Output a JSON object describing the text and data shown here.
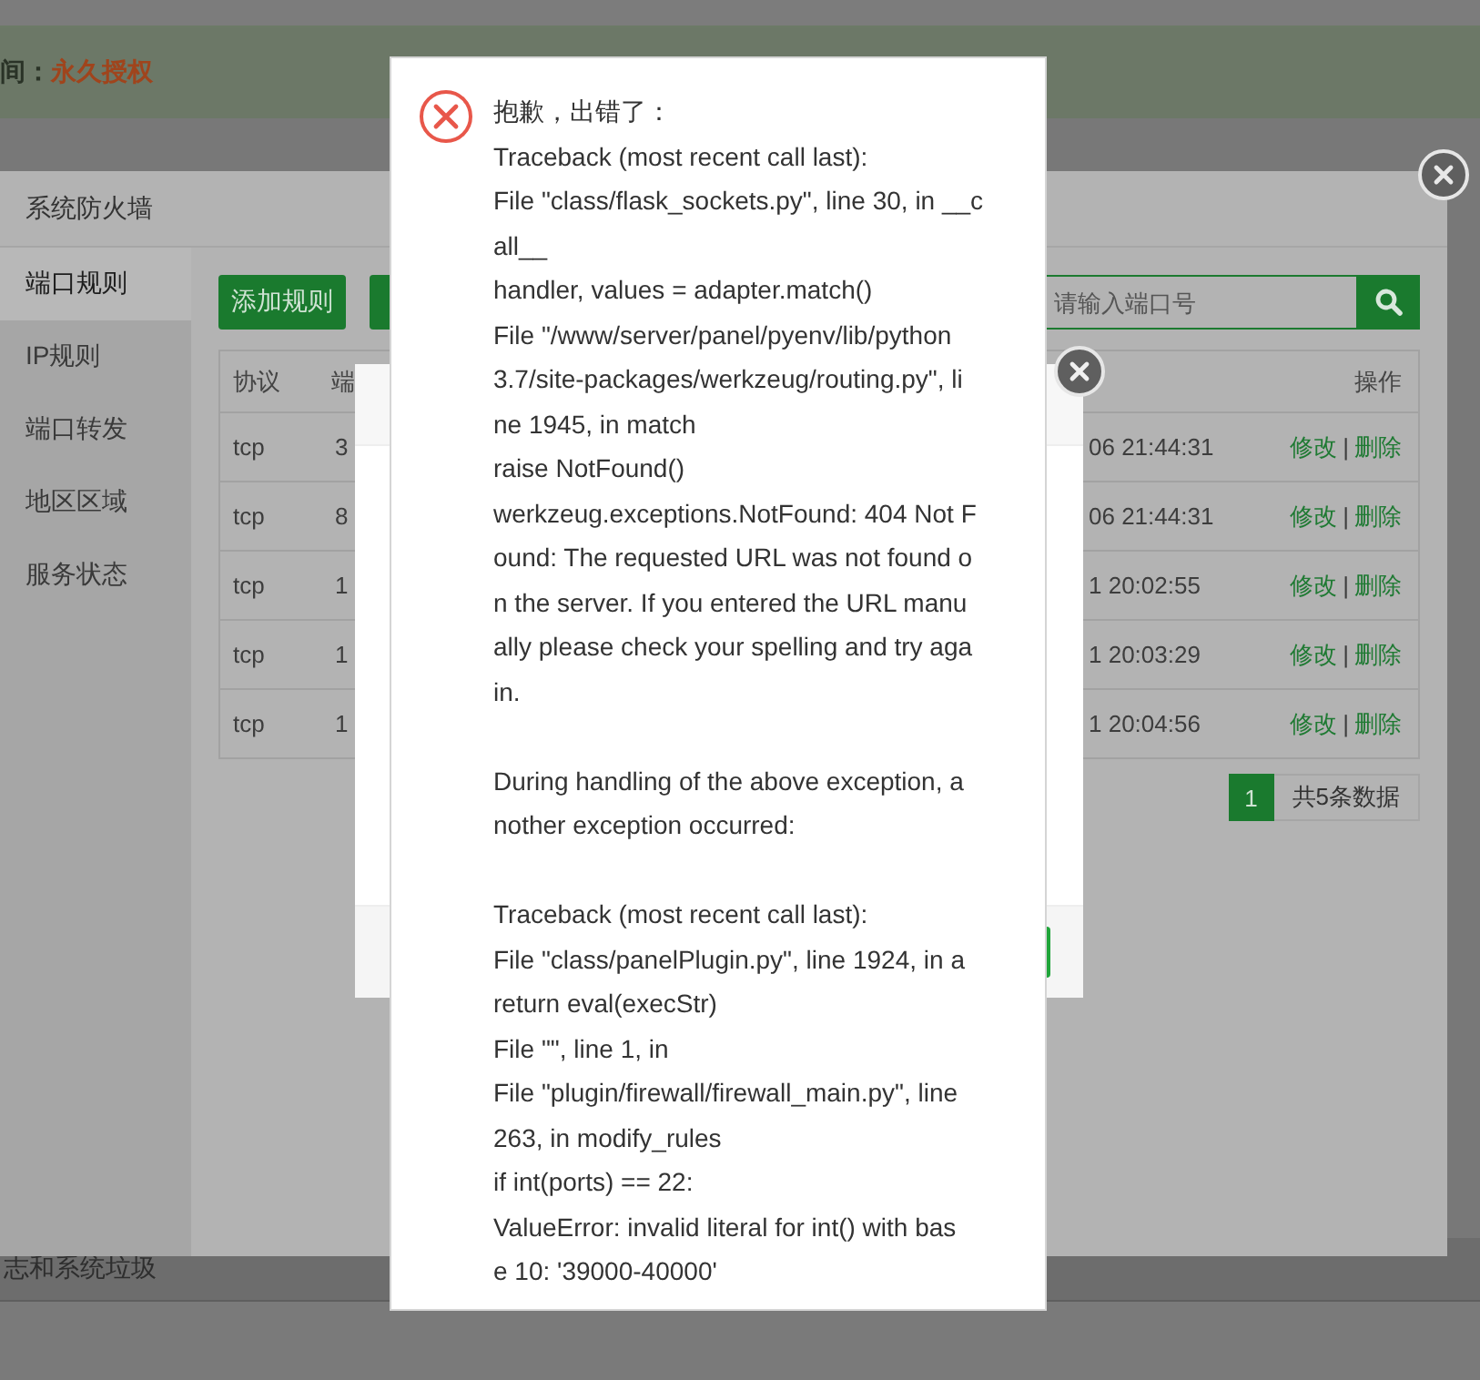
{
  "page": {
    "license_label": "间：",
    "license_value": "永久授权",
    "bottom_text": "志和系统垃圾"
  },
  "firewall_dialog": {
    "title": "系统防火墙",
    "menu": [
      {
        "label": "端口规则",
        "selected": true
      },
      {
        "label": "IP规则",
        "selected": false
      },
      {
        "label": "端口转发",
        "selected": false
      },
      {
        "label": "地区区域",
        "selected": false
      },
      {
        "label": "服务状态",
        "selected": false
      }
    ],
    "add_button": "添加规则",
    "search": {
      "placeholder": "请输入端口号"
    },
    "table": {
      "columns": [
        "协议",
        "端",
        "操作"
      ],
      "action_separator": "|",
      "rows": [
        {
          "protocol": "tcp",
          "port": "3",
          "time": "06 21:44:31",
          "edit": "修改",
          "delete": "删除"
        },
        {
          "protocol": "tcp",
          "port": "8",
          "time": "06 21:44:31",
          "edit": "修改",
          "delete": "删除"
        },
        {
          "protocol": "tcp",
          "port": "1",
          "time": "1 20:02:55",
          "edit": "修改",
          "delete": "删除"
        },
        {
          "protocol": "tcp",
          "port": "1",
          "time": "1 20:03:29",
          "edit": "修改",
          "delete": "删除"
        },
        {
          "protocol": "tcp",
          "port": "1",
          "time": "1 20:04:56",
          "edit": "修改",
          "delete": "删除"
        }
      ]
    },
    "pagination": {
      "page": "1",
      "total": "共5条数据"
    }
  },
  "error_dialog": {
    "title": "抱歉，出错了：",
    "paragraphs": [
      [
        "Traceback (most recent call last):",
        "File \"class/flask_sockets.py\", line 30, in __c",
        "all__",
        "handler, values = adapter.match()",
        "File \"/www/server/panel/pyenv/lib/python",
        "3.7/site-packages/werkzeug/routing.py\", li",
        "ne 1945, in match",
        "raise NotFound()",
        "werkzeug.exceptions.NotFound: 404 Not F",
        "ound: The requested URL was not found o",
        "n the server. If you entered the URL manu",
        "ally please check your spelling and try aga",
        "in."
      ],
      [
        "During handling of the above exception, a",
        "nother exception occurred:"
      ],
      [
        "Traceback (most recent call last):",
        "File \"class/panelPlugin.py\", line 1924, in a",
        "return eval(execStr)",
        "File \"\", line 1, in",
        "File \"plugin/firewall/firewall_main.py\", line",
        "263, in modify_rules",
        "if int(ports) == 22:",
        "ValueError: invalid literal for int() with bas",
        "e 10: '39000-40000'"
      ]
    ]
  }
}
